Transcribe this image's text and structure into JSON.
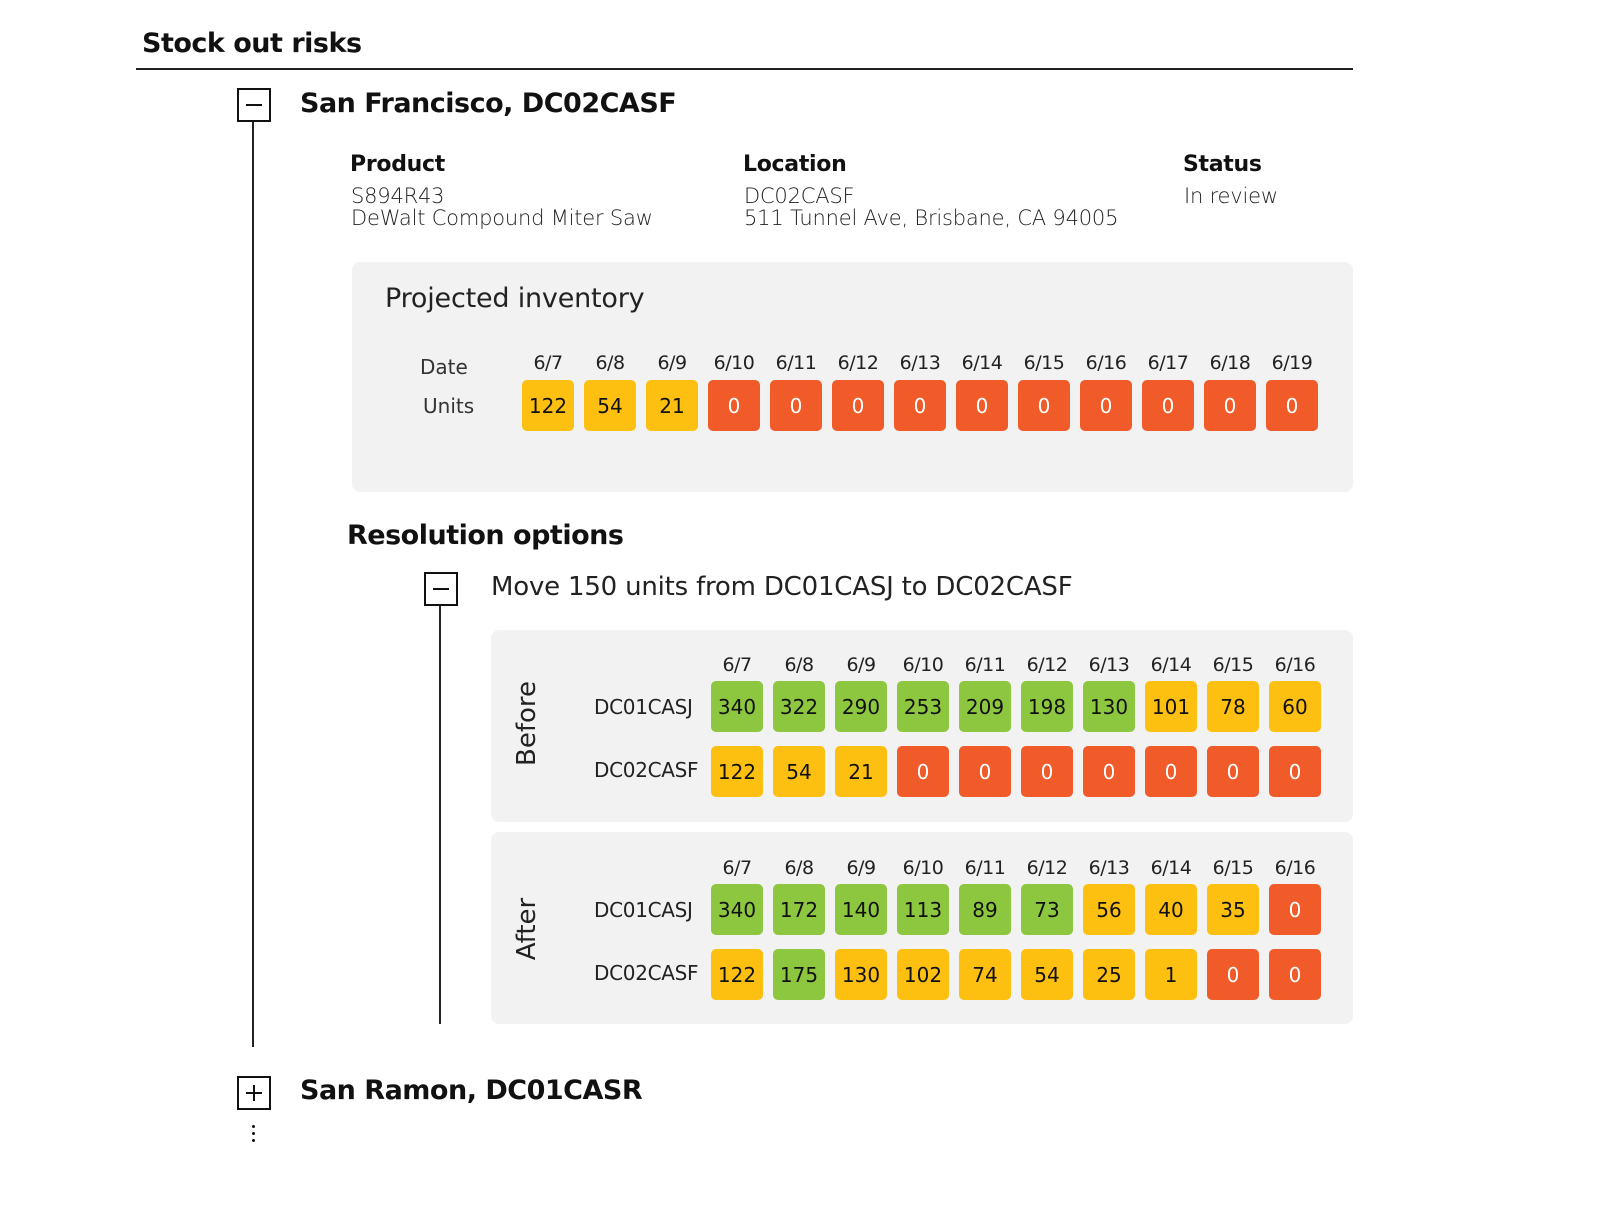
{
  "page": {
    "title": "Stock out risks"
  },
  "colors": {
    "green": "#8dc63f",
    "yellow": "#fdc010",
    "red": "#f15a29",
    "panel": "#f2f2f2"
  },
  "sites": [
    {
      "title": "San Francisco, DC02CASF",
      "expanded": true,
      "toggle_icon": "minus-box-icon",
      "product": {
        "label": "Product",
        "sku": "S894R43",
        "name": "DeWalt Compound Miter Saw"
      },
      "location": {
        "label": "Location",
        "code": "DC02CASF",
        "address": "511 Tunnel Ave, Brisbane, CA 94005"
      },
      "status": {
        "label": "Status",
        "value": "In review"
      },
      "projected_inventory": {
        "title": "Projected inventory",
        "date_label": "Date",
        "units_label": "Units",
        "dates": [
          "6/7",
          "6/8",
          "6/9",
          "6/10",
          "6/11",
          "6/12",
          "6/13",
          "6/14",
          "6/15",
          "6/16",
          "6/17",
          "6/18",
          "6/19"
        ],
        "units": [
          122,
          54,
          21,
          0,
          0,
          0,
          0,
          0,
          0,
          0,
          0,
          0,
          0
        ],
        "levels": [
          "yellow",
          "yellow",
          "yellow",
          "red",
          "red",
          "red",
          "red",
          "red",
          "red",
          "red",
          "red",
          "red",
          "red"
        ]
      },
      "resolution": {
        "title": "Resolution options",
        "options": [
          {
            "title": "Move 150 units from DC01CASJ to DC02CASF",
            "expanded": true,
            "toggle_icon": "minus-box-icon",
            "before": {
              "label": "Before",
              "dates": [
                "6/7",
                "6/8",
                "6/9",
                "6/10",
                "6/11",
                "6/12",
                "6/13",
                "6/14",
                "6/15",
                "6/16"
              ],
              "rows": [
                {
                  "dc": "DC01CASJ",
                  "values": [
                    340,
                    322,
                    290,
                    253,
                    209,
                    198,
                    130,
                    101,
                    78,
                    60
                  ],
                  "levels": [
                    "green",
                    "green",
                    "green",
                    "green",
                    "green",
                    "green",
                    "green",
                    "yellow",
                    "yellow",
                    "yellow"
                  ]
                },
                {
                  "dc": "DC02CASF",
                  "values": [
                    122,
                    54,
                    21,
                    0,
                    0,
                    0,
                    0,
                    0,
                    0,
                    0
                  ],
                  "levels": [
                    "yellow",
                    "yellow",
                    "yellow",
                    "red",
                    "red",
                    "red",
                    "red",
                    "red",
                    "red",
                    "red"
                  ]
                }
              ]
            },
            "after": {
              "label": "After",
              "dates": [
                "6/7",
                "6/8",
                "6/9",
                "6/10",
                "6/11",
                "6/12",
                "6/13",
                "6/14",
                "6/15",
                "6/16"
              ],
              "rows": [
                {
                  "dc": "DC01CASJ",
                  "values": [
                    340,
                    172,
                    140,
                    113,
                    89,
                    73,
                    56,
                    40,
                    35,
                    0
                  ],
                  "levels": [
                    "green",
                    "green",
                    "green",
                    "green",
                    "green",
                    "green",
                    "yellow",
                    "yellow",
                    "yellow",
                    "red"
                  ]
                },
                {
                  "dc": "DC02CASF",
                  "values": [
                    122,
                    175,
                    130,
                    102,
                    74,
                    54,
                    25,
                    1,
                    0,
                    0
                  ],
                  "levels": [
                    "yellow",
                    "green",
                    "yellow",
                    "yellow",
                    "yellow",
                    "yellow",
                    "yellow",
                    "yellow",
                    "red",
                    "red"
                  ]
                }
              ]
            }
          }
        ]
      }
    },
    {
      "title": "San Ramon, DC01CASR",
      "expanded": false,
      "toggle_icon": "plus-box-icon"
    }
  ],
  "more_indicator": "more-items-ellipsis"
}
